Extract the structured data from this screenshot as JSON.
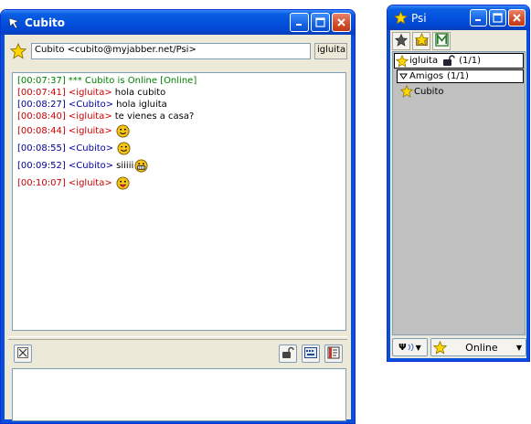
{
  "colors": {
    "accent_blue": "#0451dd",
    "online_green": "#008000",
    "self_red": "#cc0000",
    "contact_blue": "#000099",
    "star_yellow": "#ffd700"
  },
  "chat_window": {
    "title": "Cubito",
    "contact_address": "Cubito <cubito@myjabber.net/Psi>",
    "nick": "igluita",
    "messages": [
      {
        "time": "[00:07:37]",
        "nick": "",
        "text": "*** Cubito is Online [Online]",
        "kind": "status",
        "icon": ""
      },
      {
        "time": "[00:07:41]",
        "nick": "<igluita>",
        "text": "hola cubito",
        "kind": "self",
        "icon": ""
      },
      {
        "time": "[00:08:27]",
        "nick": "<Cubito>",
        "text": "hola igluita",
        "kind": "contact",
        "icon": ""
      },
      {
        "time": "[00:08:40]",
        "nick": "<igluita>",
        "text": "te vienes a casa?",
        "kind": "self",
        "icon": ""
      },
      {
        "time": "[00:08:44]",
        "nick": "<igluita>",
        "text": "",
        "kind": "self",
        "icon": "smile-emoticon-icon"
      },
      {
        "time": "[00:08:55]",
        "nick": "<Cubito>",
        "text": "",
        "kind": "contact",
        "icon": "wink-emoticon-icon"
      },
      {
        "time": "[00:09:52]",
        "nick": "<Cubito>",
        "text": "siiiii",
        "kind": "contact",
        "icon": "grin-emoticon-icon"
      },
      {
        "time": "[00:10:07]",
        "nick": "<igluita>",
        "text": "",
        "kind": "self",
        "icon": "tongue-emoticon-icon"
      }
    ],
    "compose_text": ""
  },
  "roster_window": {
    "title": "Psi",
    "self_account": "igluita",
    "self_count": "(1/1)",
    "group_name": "Amigos",
    "group_count": "(1/1)",
    "contacts": [
      {
        "name": "Cubito",
        "icon": "star-online-icon"
      }
    ],
    "status": "Online",
    "menu_glyph": "Ψ"
  }
}
